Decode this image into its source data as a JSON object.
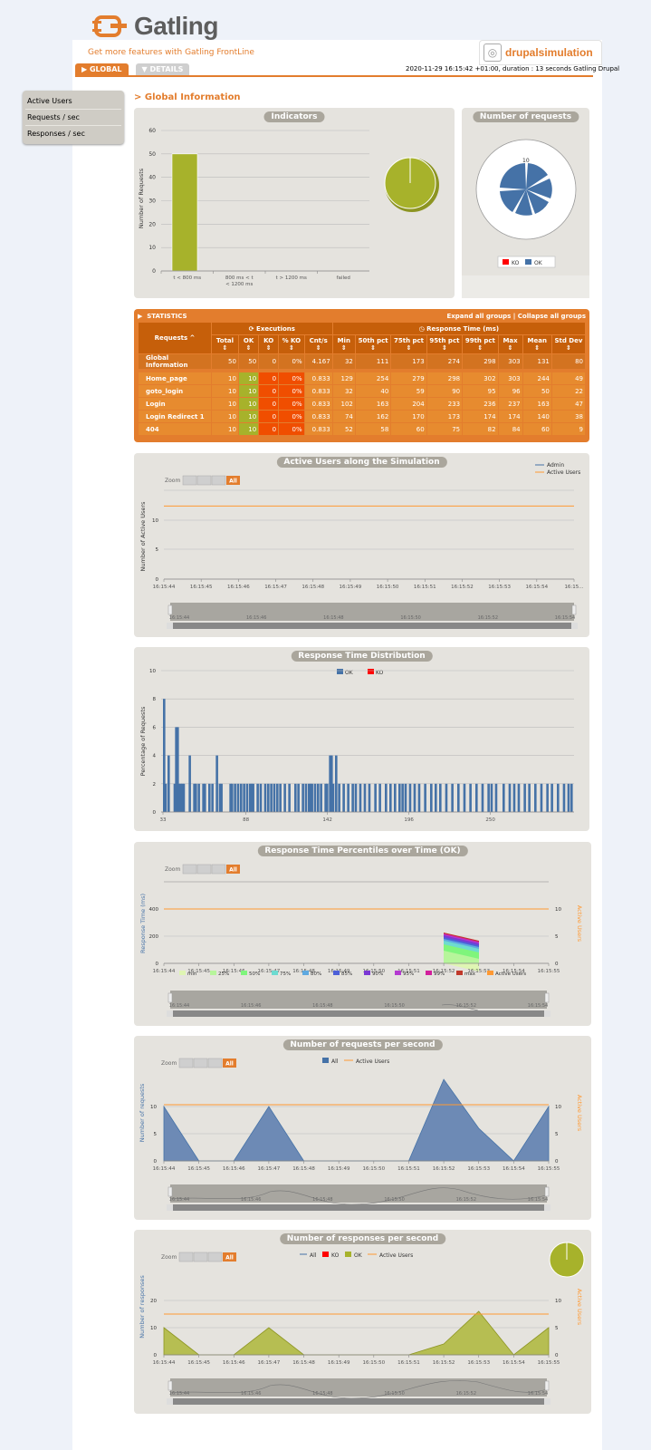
{
  "brand": {
    "logo_text": "Gatling",
    "frontline_link": "Get more features with Gatling FrontLine"
  },
  "simulation": {
    "name": "drupalsimulation"
  },
  "tabs": [
    {
      "label": "GLOBAL",
      "active": true
    },
    {
      "label": "DETAILS",
      "active": false
    }
  ],
  "run_info": "2020-11-29 16:15:42 +01:00, duration : 13 seconds Gatling Drupal",
  "sidebar": {
    "items": [
      {
        "label": "Active Users"
      },
      {
        "label": "Requests / sec"
      },
      {
        "label": "Responses / sec"
      }
    ]
  },
  "page_title": "Global Information",
  "colors": {
    "accent": "#e37d2d",
    "ok": "#a7b22b",
    "ko": "#ff0000",
    "blue": "#4572a7",
    "panel": "#e5e3de"
  },
  "indicators": {
    "title": "Indicators",
    "chart_data": {
      "type": "bar",
      "categories": [
        "t < 800 ms",
        "800 ms < t < 1200 ms",
        "t > 1200 ms",
        "failed"
      ],
      "values": [
        50,
        0,
        0,
        0
      ],
      "ylabel": "Number of Requests",
      "yticks": [
        "0",
        "10",
        "20",
        "30",
        "40",
        "50",
        "60"
      ],
      "ylim": [
        0,
        60
      ]
    }
  },
  "number_of_requests": {
    "title": "Number of requests",
    "center_label": "10",
    "legend": {
      "ko": "KO",
      "ok": "OK"
    }
  },
  "stats": {
    "title": "STATISTICS",
    "expand_all": "Expand all groups",
    "separator": "|",
    "collapse_all": "Collapse all groups",
    "executions_label": "Executions",
    "response_time_label": "Response Time (ms)",
    "columns": [
      "Requests ^",
      "Total ⇕",
      "OK ⇕",
      "KO ⇕",
      "% KO ⇕",
      "Cnt/s ⇕",
      "Min ⇕",
      "50th pct ⇕",
      "75th pct ⇕",
      "95th pct ⇕",
      "99th pct ⇕",
      "Max ⇕",
      "Mean ⇕",
      "Std Dev ⇕"
    ],
    "rows": [
      {
        "name": "Global Information",
        "total": "50",
        "ok": "50",
        "ko": "0",
        "pko": "0%",
        "cnt": "4.167",
        "min": "32",
        "p50": "111",
        "p75": "173",
        "p95": "274",
        "p99": "298",
        "max": "303",
        "mean": "131",
        "std": "80"
      },
      {
        "name": "Home_page",
        "total": "10",
        "ok": "10",
        "ko": "0",
        "pko": "0%",
        "cnt": "0.833",
        "min": "129",
        "p50": "254",
        "p75": "279",
        "p95": "298",
        "p99": "302",
        "max": "303",
        "mean": "244",
        "std": "49"
      },
      {
        "name": "goto_login",
        "total": "10",
        "ok": "10",
        "ko": "0",
        "pko": "0%",
        "cnt": "0.833",
        "min": "32",
        "p50": "40",
        "p75": "59",
        "p95": "90",
        "p99": "95",
        "max": "96",
        "mean": "50",
        "std": "22"
      },
      {
        "name": "Login",
        "total": "10",
        "ok": "10",
        "ko": "0",
        "pko": "0%",
        "cnt": "0.833",
        "min": "102",
        "p50": "163",
        "p75": "204",
        "p95": "233",
        "p99": "236",
        "max": "237",
        "mean": "163",
        "std": "47"
      },
      {
        "name": "Login Redirect 1",
        "total": "10",
        "ok": "10",
        "ko": "0",
        "pko": "0%",
        "cnt": "0.833",
        "min": "74",
        "p50": "162",
        "p75": "170",
        "p95": "173",
        "p99": "174",
        "max": "174",
        "mean": "140",
        "std": "38"
      },
      {
        "name": "404",
        "total": "10",
        "ok": "10",
        "ko": "0",
        "pko": "0%",
        "cnt": "0.833",
        "min": "52",
        "p50": "58",
        "p75": "60",
        "p95": "75",
        "p99": "82",
        "max": "84",
        "mean": "60",
        "std": "9"
      }
    ]
  },
  "times": [
    "16:15:44",
    "16:15:45",
    "16:15:46",
    "16:15:47",
    "16:15:48",
    "16:15:49",
    "16:15:50",
    "16:15:51",
    "16:15:52",
    "16:15:53",
    "16:15:54",
    "16:15:55"
  ],
  "times_short": [
    "16:15:44",
    "16:15:45",
    "16:15:46",
    "16:15:47",
    "16:15:48",
    "16:15:49",
    "16:15:50",
    "16:15:51",
    "16:15:52",
    "16:15:53",
    "16:15:54",
    "16:15..."
  ],
  "nav_times": [
    "16:15:44",
    "16:15:46",
    "16:15:48",
    "16:15:50",
    "16:15:52",
    "16:15:54"
  ],
  "zoom": {
    "label": "Zoom",
    "all": "All"
  },
  "active_users": {
    "title": "Active Users along the Simulation",
    "legend": [
      "Admin",
      "Active Users"
    ],
    "chart_data": {
      "type": "line",
      "ylabel": "Number of Active Users",
      "yticks": [
        "0",
        "5",
        "10"
      ],
      "ylim": [
        0,
        15
      ],
      "series": [
        {
          "name": "Active Users",
          "values": [
            10,
            10,
            10,
            10,
            10,
            10,
            10,
            10,
            10,
            10,
            10,
            10
          ]
        }
      ]
    }
  },
  "distribution": {
    "title": "Response Time Distribution",
    "legend": [
      "OK",
      "KO"
    ],
    "chart_data": {
      "type": "bar",
      "ylabel": "Percentage of Requests",
      "yticks": [
        "0",
        "2",
        "4",
        "6",
        "8",
        "10"
      ],
      "ylim": [
        0,
        10
      ],
      "xticks": [
        "33",
        "88",
        "142",
        "196",
        "250"
      ],
      "x": [
        33,
        34,
        36,
        40,
        41,
        42,
        43,
        44,
        45,
        46,
        50,
        53,
        54,
        56,
        59,
        60,
        63,
        65,
        68,
        70,
        71,
        77,
        78,
        80,
        82,
        84,
        86,
        88,
        90,
        91,
        92,
        95,
        97,
        100,
        102,
        104,
        106,
        108,
        110,
        113,
        116,
        120,
        122,
        125,
        127,
        129,
        130,
        131,
        133,
        135,
        137,
        140,
        141,
        143,
        144,
        145,
        147,
        149,
        152,
        155,
        158,
        160,
        163,
        166,
        169,
        173,
        176,
        180,
        183,
        186,
        189,
        191,
        193,
        196,
        199,
        202,
        206,
        210,
        213,
        216,
        220,
        224,
        228,
        232,
        236,
        240,
        244,
        248,
        250,
        253,
        258,
        262,
        265,
        268,
        272,
        275,
        279,
        283,
        287,
        290,
        294,
        298,
        301,
        303
      ],
      "values": [
        8,
        2,
        4,
        2,
        6,
        6,
        2,
        2,
        2,
        2,
        4,
        2,
        2,
        2,
        2,
        2,
        2,
        2,
        4,
        2,
        2,
        2,
        2,
        2,
        2,
        2,
        2,
        2,
        2,
        2,
        2,
        2,
        2,
        2,
        2,
        2,
        2,
        2,
        2,
        2,
        2,
        2,
        2,
        2,
        2,
        2,
        2,
        2,
        2,
        2,
        2,
        2,
        2,
        4,
        4,
        2,
        4,
        2,
        2,
        2,
        2,
        2,
        2,
        2,
        2,
        2,
        2,
        2,
        2,
        2,
        2,
        2,
        2,
        2,
        2,
        2,
        2,
        2,
        2,
        2,
        2,
        2,
        2,
        2,
        2,
        2,
        2,
        2,
        2,
        2,
        2,
        2,
        2,
        2,
        2,
        2,
        2,
        2,
        2,
        2,
        2,
        2,
        2,
        2
      ]
    }
  },
  "percentiles": {
    "title": "Response Time Percentiles over Time (OK)",
    "legend": [
      "min",
      "25%",
      "50%",
      "75%",
      "80%",
      "85%",
      "90%",
      "95%",
      "99%",
      "max",
      "Active Users"
    ],
    "legend_colors": [
      "#dff5b3",
      "#b7f59b",
      "#7ff57c",
      "#6ddbd0",
      "#5ea9e0",
      "#4d60d8",
      "#7b38d4",
      "#b43ad0",
      "#d21f9c",
      "#c0392b",
      "#ff9933"
    ],
    "chart_data": {
      "type": "area",
      "ylabel": "Response Time (ms)",
      "y2label": "Active Users",
      "yticks": [
        "0",
        "200",
        "400"
      ],
      "y2ticks": [
        "0",
        "5",
        "10"
      ],
      "ylim": [
        0,
        600
      ]
    }
  },
  "requests_per_sec": {
    "title": "Number of requests per second",
    "legend": [
      "All",
      "Active Users"
    ],
    "chart_data": {
      "type": "area",
      "ylabel": "Number of requests",
      "y2label": "Active Users",
      "yticks": [
        "0",
        "5",
        "10"
      ],
      "y2ticks": [
        "0",
        "5",
        "10"
      ],
      "ylim": [
        0,
        15
      ],
      "series": [
        {
          "name": "All",
          "values": [
            10,
            0,
            0,
            10,
            0,
            0,
            0,
            0,
            15,
            6,
            0,
            10
          ]
        },
        {
          "name": "Active Users",
          "values": [
            10,
            10,
            10,
            10,
            10,
            10,
            10,
            10,
            10,
            10,
            10,
            10
          ]
        }
      ]
    }
  },
  "responses_per_sec": {
    "title": "Number of responses per second",
    "legend": [
      "All",
      "KO",
      "OK",
      "Active Users"
    ],
    "chart_data": {
      "type": "area",
      "ylabel": "Number of responses",
      "y2label": "Active Users",
      "yticks": [
        "0",
        "10",
        "20"
      ],
      "y2ticks": [
        "0",
        "5",
        "10"
      ],
      "ylim": [
        0,
        30
      ],
      "series": [
        {
          "name": "OK",
          "values": [
            10,
            0,
            0,
            10,
            0,
            0,
            0,
            0,
            4,
            16,
            0,
            10
          ]
        },
        {
          "name": "Active Users",
          "values": [
            10,
            10,
            10,
            10,
            10,
            10,
            10,
            10,
            10,
            10,
            10,
            10
          ]
        }
      ]
    }
  }
}
